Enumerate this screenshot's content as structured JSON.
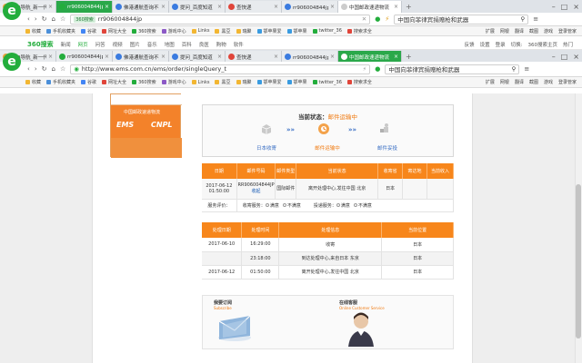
{
  "tabs_top": [
    {
      "label": "360导航_新一代安全...",
      "color": "#e8a13a",
      "state": "normal"
    },
    {
      "label": "rr906004844jp_360...",
      "color": "#23ad3c",
      "state": "green"
    },
    {
      "label": "佛港通航查询不到_...",
      "color": "#3a7be0",
      "state": "normal"
    },
    {
      "label": "提问_百度知道",
      "color": "#3a7be0",
      "state": "normal"
    },
    {
      "label": "查快递",
      "color": "#e0453a",
      "state": "normal"
    },
    {
      "label": "rr906004844jp_百度...",
      "color": "#3a7be0",
      "state": "normal"
    },
    {
      "label": "中国邮政速递物流",
      "color": "#cccccc",
      "state": "active"
    }
  ],
  "browser_top": {
    "url": "rr906004844jp",
    "search_engine": "360搜索",
    "search_text": "中国向菲律宾捐赠枪和武器",
    "bookmarks": [
      "收藏",
      "手机收藏夹",
      "谷歌",
      "网址大全",
      "360搜索",
      "游戏中心",
      "Links",
      "黑豆",
      "瑞聚",
      "鄂苹果爱",
      "鄂苹果",
      "twitter_36",
      "搜索求全"
    ],
    "ext_labels": [
      "扩展",
      "网银",
      "翻译",
      "截图",
      "游戏"
    ],
    "right_label": "登录管家"
  },
  "site_nav": {
    "logo_text": "360搜索",
    "items": [
      "新闻",
      "网页",
      "问答",
      "视频",
      "图片",
      "音乐",
      "地图",
      "百科",
      "良医",
      "购物",
      "软件"
    ],
    "right_items": [
      "反馈",
      "设置",
      "登录",
      "切换:",
      "360搜索主页",
      "热门"
    ]
  },
  "tabs_bottom": [
    {
      "label": "360导航_新一代安全...",
      "color": "#e8a13a",
      "state": "normal"
    },
    {
      "label": "rr906004844jp_360...",
      "color": "#23ad3c",
      "state": "normal"
    },
    {
      "label": "佛港通航查询不到_...",
      "color": "#3a7be0",
      "state": "normal"
    },
    {
      "label": "提问_百度知道",
      "color": "#3a7be0",
      "state": "normal"
    },
    {
      "label": "查快递",
      "color": "#e0453a",
      "state": "normal"
    },
    {
      "label": "rr906004844jp_百度...",
      "color": "#3a7be0",
      "state": "normal"
    },
    {
      "label": "中国邮政速递物流",
      "color": "#ffffff",
      "state": "green"
    }
  ],
  "browser_bottom": {
    "url": "http://www.ems.com.cn/ems/order/singleQuery_t",
    "search_text": "中国向菲律宾捐赠枪和武器",
    "bookmarks": [
      "收藏",
      "手机收藏夹",
      "谷歌",
      "网址大全",
      "360搜索",
      "游戏中心",
      "Links",
      "黑豆",
      "瑞聚",
      "鄂苹果爱",
      "鄂苹果",
      "twitter_36",
      "搜索求全"
    ],
    "ext_labels": [
      "扩展",
      "网银",
      "翻译",
      "截图",
      "游戏"
    ],
    "right_label": "登录管家"
  },
  "ems_logo": {
    "line1": "中国邮政速递物流",
    "ems": "EMS",
    "cnpl": "CNPL"
  },
  "status": {
    "label": "当前状态：",
    "value": "邮件运输中",
    "steps": [
      {
        "label": "日本收寄",
        "active": false
      },
      {
        "label": "邮件运输中",
        "active": true
      },
      {
        "label": "邮件妥投",
        "active": false
      }
    ]
  },
  "mail_table": {
    "headers": [
      "日期",
      "邮件号码",
      "邮件类型",
      "当前状态",
      "收寄省",
      "寄达地",
      "当前收入"
    ],
    "row": {
      "date": "2017-06-12 01:50:00",
      "number": "RR906004844JP",
      "link": "收起",
      "type": "国际邮件",
      "status": "离开处理中心,发往中国 北京",
      "origin": "日本",
      "dest": "",
      "recv": ""
    },
    "rating_label": "服务评价：",
    "rating_groups": [
      {
        "label": "收寄服务：",
        "options": [
          "满意",
          "不满意"
        ]
      },
      {
        "label": "投递服务：",
        "options": [
          "满意",
          "不满意"
        ]
      }
    ]
  },
  "track_table": {
    "headers": [
      "处理日期",
      "处理时间",
      "处理信息",
      "当前位置"
    ],
    "rows": [
      {
        "date": "2017-06-10",
        "time": "16:29:00",
        "info": "收寄",
        "loc": "日本"
      },
      {
        "date": "",
        "time": "23:18:00",
        "info": "到达处理中心,来自日本 东京",
        "loc": "日本"
      },
      {
        "date": "2017-06-12",
        "time": "01:50:00",
        "info": "离开处理中心,发往中国 北京",
        "loc": "日本"
      }
    ]
  },
  "promo": {
    "left_title": "我要订阅",
    "left_sub": "Subscribe",
    "right_title": "在线客服",
    "right_sub": "Online Customer Service"
  }
}
